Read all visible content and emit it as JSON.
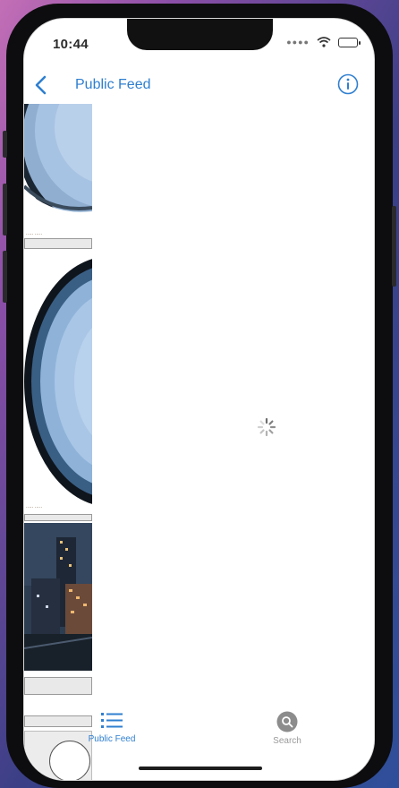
{
  "status_bar": {
    "time": "10:44"
  },
  "nav": {
    "title": "Public Feed"
  },
  "feed": {
    "captions": [
      "·····  ·····",
      "·····  ·····"
    ]
  },
  "tab_bar": {
    "tabs": [
      {
        "label": "Public Feed",
        "icon": "list-icon",
        "active": true
      },
      {
        "label": "Search",
        "icon": "search-icon",
        "active": false
      }
    ]
  },
  "colors": {
    "accent": "#2f7fd0",
    "inactive": "#9a9a9a"
  }
}
